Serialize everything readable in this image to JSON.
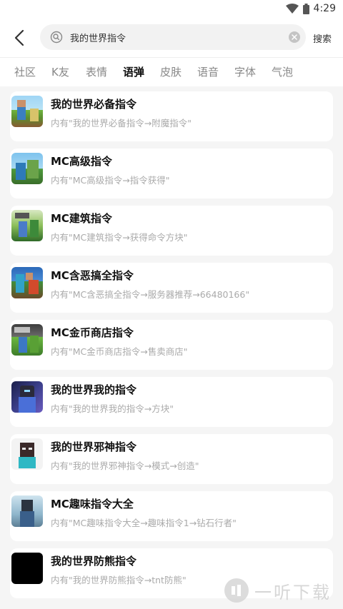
{
  "status_bar": {
    "time": "4:29",
    "wifi_icon": "wifi-icon",
    "battery_icon": "battery-icon"
  },
  "search": {
    "query": "我的世界指令",
    "button_label": "搜索",
    "back_icon": "chevron-left-icon",
    "search_icon": "search-icon",
    "clear_icon": "close-circle-icon"
  },
  "tabs": [
    {
      "label": "社区",
      "active": false
    },
    {
      "label": "K友",
      "active": false
    },
    {
      "label": "表情",
      "active": false
    },
    {
      "label": "语弹",
      "active": true
    },
    {
      "label": "皮肤",
      "active": false
    },
    {
      "label": "语音",
      "active": false
    },
    {
      "label": "字体",
      "active": false
    },
    {
      "label": "气泡",
      "active": false
    }
  ],
  "colors": {
    "accent": "#ffd200",
    "background": "#f5f5f5",
    "card": "#ffffff",
    "subtitle": "#aaaaaa"
  },
  "results": [
    {
      "title": "我的世界必备指令",
      "subtitle": "内有\"我的世界必备指令→附魔指令\""
    },
    {
      "title": "MC高级指令",
      "subtitle": "内有\"MC高级指令→指令获得\""
    },
    {
      "title": "MC建筑指令",
      "subtitle": "内有\"MC建筑指令→获得命令方块\""
    },
    {
      "title": "MC含恶搞全指令",
      "subtitle": "内有\"MC含恶搞全指令→服务器推荐→66480166\""
    },
    {
      "title": "MC金币商店指令",
      "subtitle": "内有\"MC金币商店指令→售卖商店\""
    },
    {
      "title": "我的世界我的指令",
      "subtitle": "内有\"我的世界我的指令→方块\""
    },
    {
      "title": "我的世界邪神指令",
      "subtitle": "内有\"我的世界邪神指令→模式→创造\""
    },
    {
      "title": "MC趣味指令大全",
      "subtitle": "内有\"MC趣味指令大全→趣味指令1→钻石行者\""
    },
    {
      "title": "我的世界防熊指令",
      "subtitle": "内有\"我的世界防熊指令→tnt防熊\""
    }
  ],
  "watermark": {
    "text": "一听下载"
  }
}
